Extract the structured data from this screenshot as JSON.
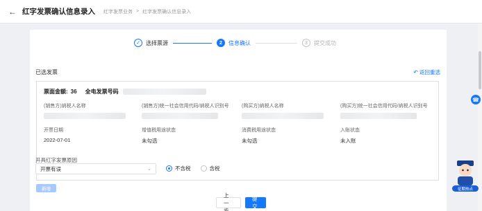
{
  "header": {
    "back_icon": "arrow-left-icon",
    "title": "红字发票确认信息录入",
    "breadcrumb": [
      "红字发票业务",
      "红字发票确认信息录入"
    ]
  },
  "steps": [
    {
      "index": "✓",
      "label": "选择票源",
      "state": "done"
    },
    {
      "index": "2",
      "label": "信息确认",
      "state": "active"
    },
    {
      "index": "3",
      "label": "提交成功",
      "state": "todo"
    }
  ],
  "section": {
    "title": "已选发票",
    "return_link": "返回重选"
  },
  "invoice": {
    "amount_label": "票面金额:",
    "amount_value": "36",
    "number_label": "全电发票号码",
    "row1": {
      "seller_name_label": "(销售方)纳税人名称",
      "seller_id_label": "(销售方)统一社会信用代码/纳税人识别号",
      "buyer_name_label": "(购买方)纳税人名称",
      "buyer_id_label": "(购买方)统一社会信用代码/纳税人识别号"
    },
    "row2": {
      "issue_date_label": "开票日期",
      "issue_date_value": "2022-07-01",
      "vat_status_label": "增值税用途状态",
      "vat_status_value": "未勾选",
      "consumption_status_label": "消费税用途状态",
      "consumption_status_value": "未勾选",
      "entry_status_label": "入账状态",
      "entry_status_value": "未入账"
    }
  },
  "reason": {
    "label": "开具红字发票原因",
    "selected": "开票有误",
    "options": [
      {
        "label": "不含税",
        "checked": true
      },
      {
        "label": "含税",
        "checked": false
      }
    ]
  },
  "add_button": "新增",
  "footer": {
    "prev": "上一步",
    "submit": "提交"
  },
  "assistant": {
    "label": "征期热点"
  },
  "colors": {
    "accent": "#1677ff",
    "background": "#eef0f4"
  }
}
